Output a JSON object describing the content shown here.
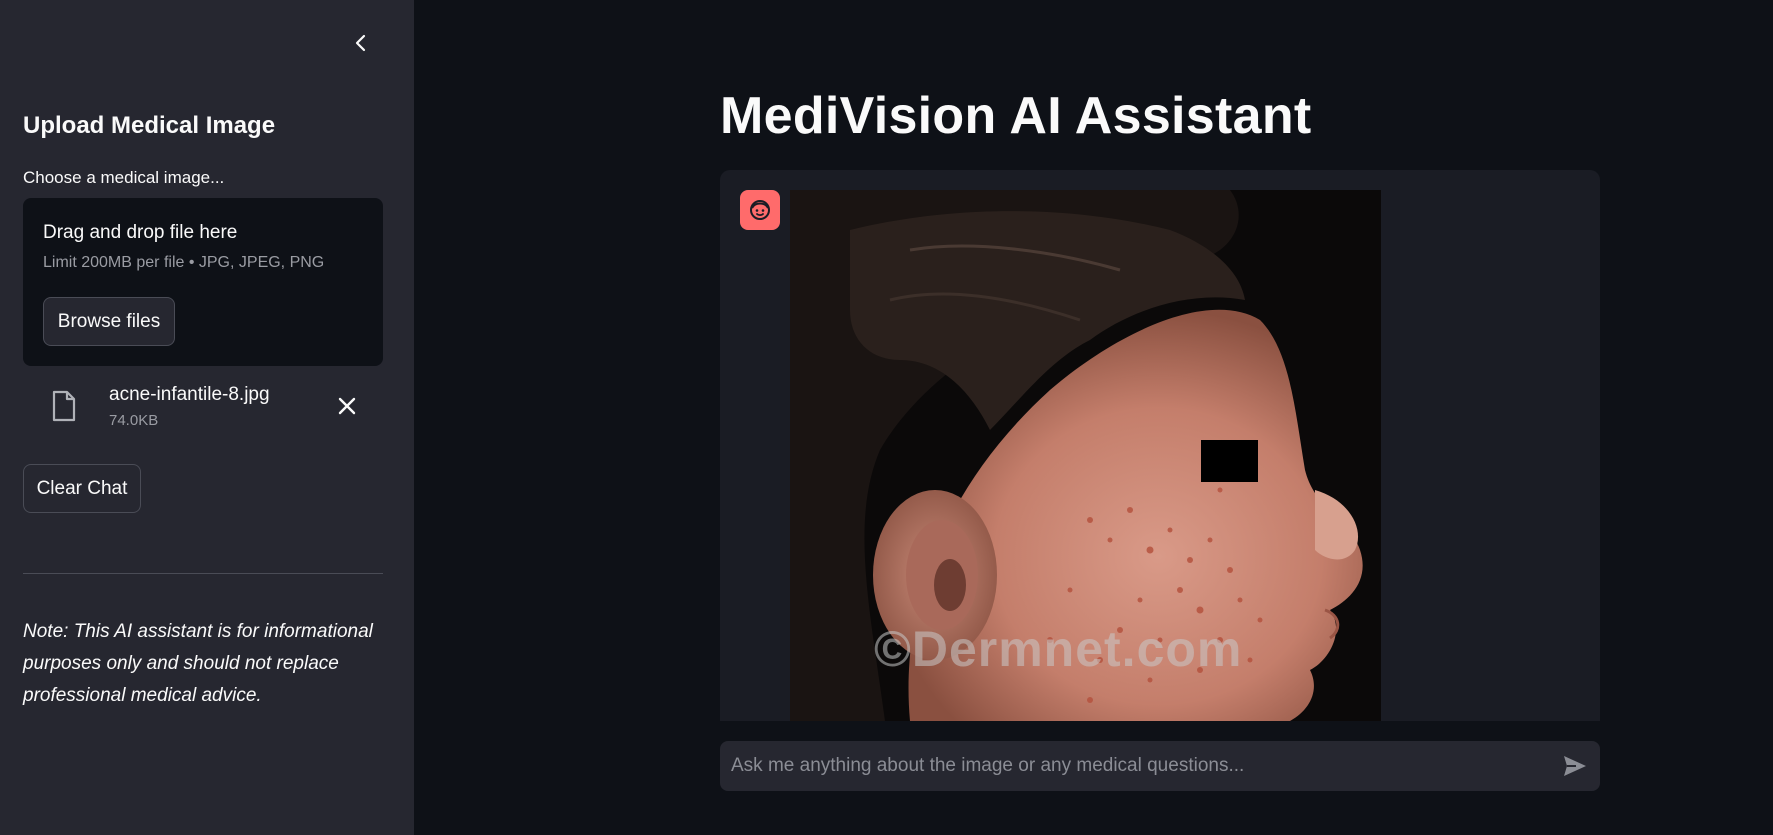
{
  "sidebar": {
    "title": "Upload Medical Image",
    "uploader_label": "Choose a medical image...",
    "dropzone": {
      "title": "Drag and drop file here",
      "limit": "Limit 200MB per file • JPG, JPEG, PNG",
      "browse_label": "Browse files"
    },
    "file": {
      "name": "acne-infantile-8.jpg",
      "size": "74.0KB"
    },
    "clear_label": "Clear Chat",
    "note": "Note: This AI assistant is for informational purposes only and should not replace professional medical advice."
  },
  "main": {
    "title": "MediVision AI Assistant",
    "message": {
      "image_watermark": "©Dermnet.com"
    },
    "chat_input": {
      "placeholder": "Ask me anything about the image or any medical questions..."
    }
  },
  "colors": {
    "background": "#0e1117",
    "sidebar": "#262730",
    "avatar": "#ff6b6b"
  },
  "icons": {
    "collapse": "chevron-left-icon",
    "file": "file-icon",
    "remove": "close-icon",
    "avatar": "face-icon",
    "send": "send-icon"
  }
}
